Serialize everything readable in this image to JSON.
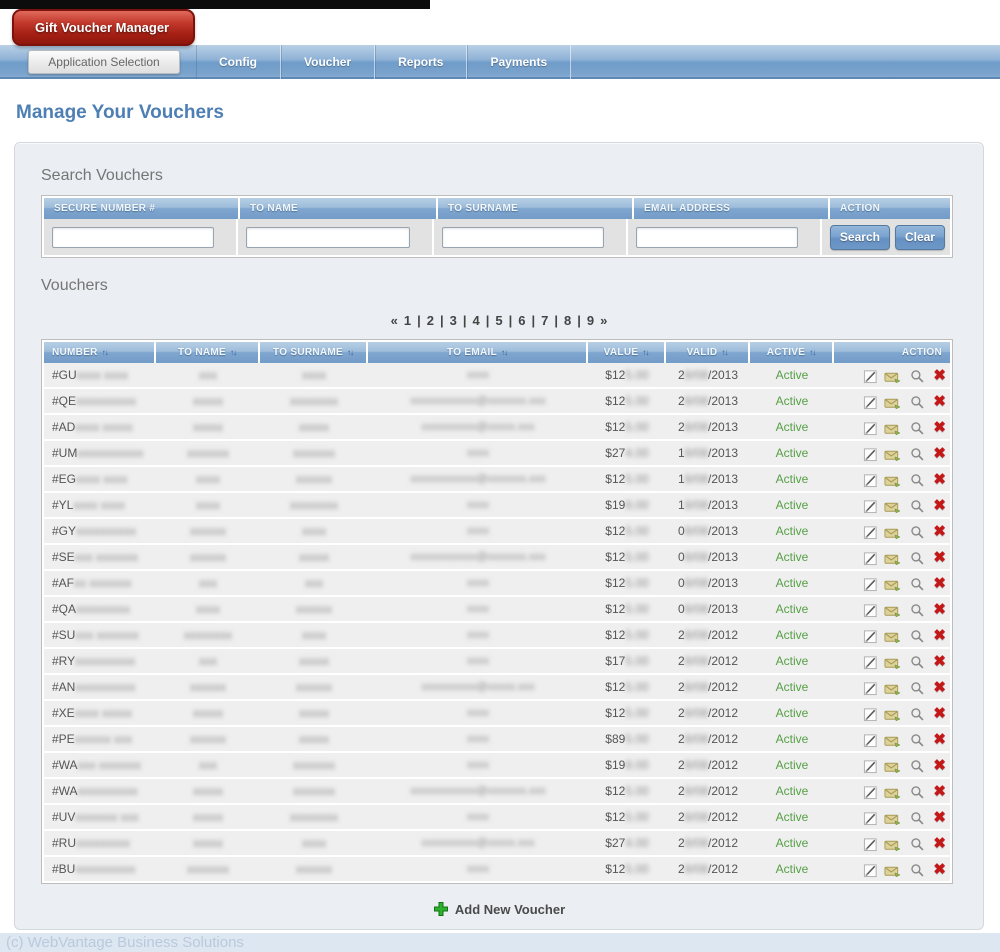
{
  "app": {
    "logo_label": "Gift Voucher Manager",
    "footer": "(c) WebVantage Business Solutions"
  },
  "nav": {
    "app_selection_label": "Application Selection",
    "tabs": [
      {
        "label": "Config"
      },
      {
        "label": "Voucher"
      },
      {
        "label": "Reports"
      },
      {
        "label": "Payments"
      }
    ]
  },
  "page": {
    "title": "Manage Your Vouchers"
  },
  "search": {
    "heading": "Search Vouchers",
    "columns": [
      "SECURE NUMBER #",
      "TO NAME",
      "TO SURNAME",
      "EMAIL ADDRESS",
      "ACTION"
    ],
    "inputs": [
      {
        "name": "secure-number-input",
        "value": ""
      },
      {
        "name": "to-name-input",
        "value": ""
      },
      {
        "name": "to-surname-input",
        "value": ""
      },
      {
        "name": "email-address-input",
        "value": ""
      }
    ],
    "search_label": "Search",
    "clear_label": "Clear"
  },
  "vouchers": {
    "heading": "Vouchers",
    "pagination": {
      "prev": "«",
      "pages": [
        "1",
        "2",
        "3",
        "4",
        "5",
        "6",
        "7",
        "8",
        "9"
      ],
      "separator": "|",
      "next": "»"
    },
    "columns": [
      "NUMBER",
      "TO NAME",
      "TO SURNAME",
      "TO EMAIL",
      "VALUE",
      "VALID",
      "ACTIVE",
      "ACTION"
    ],
    "sort_glyph": "↑↓",
    "add_label": "Add New Voucher",
    "rows": [
      {
        "n": "#GU",
        "nb": "xxxx xxxx",
        "nm": "xxx",
        "sn": "xxxx",
        "em": "xxxx",
        "v": "$12",
        "vb": "5.00",
        "d": "2",
        "db": "8/08",
        "y": "/2013",
        "active": "Active"
      },
      {
        "n": "#QE",
        "nb": "xxxxxxxxxx",
        "nm": "xxxxx",
        "sn": "xxxxxxxx",
        "em": "xxxxxxxxxxxx@xxxxxxx.xxx",
        "v": "$12",
        "vb": "5.00",
        "d": "2",
        "db": "8/08",
        "y": "/2013",
        "active": "Active"
      },
      {
        "n": "#AD",
        "nb": "xxxx xxxxx",
        "nm": "xxxxx",
        "sn": "xxxxx",
        "em": "xxxxxxxxxx@xxxxx.xxx",
        "v": "$12",
        "vb": "5.00",
        "d": "2",
        "db": "8/08",
        "y": "/2013",
        "active": "Active"
      },
      {
        "n": "#UM",
        "nb": "xxxxxxxxxxx",
        "nm": "xxxxxxx",
        "sn": "xxxxxxx",
        "em": "xxxx",
        "v": "$27",
        "vb": "4.00",
        "d": "1",
        "db": "8/08",
        "y": "/2013",
        "active": "Active"
      },
      {
        "n": "#EG",
        "nb": "xxxx xxxx",
        "nm": "xxxx",
        "sn": "xxxxxx",
        "em": "xxxxxxxxxxxx@xxxxxxx.xxx",
        "v": "$12",
        "vb": "5.00",
        "d": "1",
        "db": "8/08",
        "y": "/2013",
        "active": "Active"
      },
      {
        "n": "#YL",
        "nb": "xxxx xxxx",
        "nm": "xxxx",
        "sn": "xxxxxxxx",
        "em": "xxxx",
        "v": "$19",
        "vb": "8.00",
        "d": "1",
        "db": "8/08",
        "y": "/2013",
        "active": "Active"
      },
      {
        "n": "#GY",
        "nb": "xxxxxxxxxx",
        "nm": "xxxxxx",
        "sn": "xxxx",
        "em": "xxxx",
        "v": "$12",
        "vb": "5.00",
        "d": "0",
        "db": "8/08",
        "y": "/2013",
        "active": "Active"
      },
      {
        "n": "#SE",
        "nb": "xxx xxxxxxx",
        "nm": "xxxxxx",
        "sn": "xxxxx",
        "em": "xxxxxxxxxxxx@xxxxxxx.xxx",
        "v": "$12",
        "vb": "5.00",
        "d": "0",
        "db": "8/08",
        "y": "/2013",
        "active": "Active"
      },
      {
        "n": "#AF",
        "nb": "xx xxxxxxx",
        "nm": "xxx",
        "sn": "xxx",
        "em": "xxxx",
        "v": "$12",
        "vb": "5.00",
        "d": "0",
        "db": "8/08",
        "y": "/2013",
        "active": "Active"
      },
      {
        "n": "#QA",
        "nb": "xxxxxxxxx",
        "nm": "xxxx",
        "sn": "xxxxxx",
        "em": "xxxx",
        "v": "$12",
        "vb": "5.00",
        "d": "0",
        "db": "8/08",
        "y": "/2013",
        "active": "Active"
      },
      {
        "n": "#SU",
        "nb": "xxx xxxxxxx",
        "nm": "xxxxxxxx",
        "sn": "xxxx",
        "em": "xxxx",
        "v": "$12",
        "vb": "5.00",
        "d": "2",
        "db": "8/08",
        "y": "/2012",
        "active": "Active"
      },
      {
        "n": "#RY",
        "nb": "xxxxxxxxxx",
        "nm": "xxx",
        "sn": "xxxxx",
        "em": "xxxx",
        "v": "$17",
        "vb": "5.00",
        "d": "2",
        "db": "8/08",
        "y": "/2012",
        "active": "Active"
      },
      {
        "n": "#AN",
        "nb": "xxxxxxxxxx",
        "nm": "xxxxxx",
        "sn": "xxxxxx",
        "em": "xxxxxxxxxx@xxxxx.xxx",
        "v": "$12",
        "vb": "5.00",
        "d": "2",
        "db": "8/08",
        "y": "/2012",
        "active": "Active"
      },
      {
        "n": "#XE",
        "nb": "xxxx xxxxx",
        "nm": "xxxxx",
        "sn": "xxxxx",
        "em": "xxxx",
        "v": "$12",
        "vb": "5.00",
        "d": "2",
        "db": "8/08",
        "y": "/2012",
        "active": "Active"
      },
      {
        "n": "#PE",
        "nb": "xxxxxx xxx",
        "nm": "xxxxxx",
        "sn": "xxxxx",
        "em": "xxxx",
        "v": "$89",
        "vb": "5.00",
        "d": "2",
        "db": "8/08",
        "y": "/2012",
        "active": "Active"
      },
      {
        "n": "#WA",
        "nb": "xxx xxxxxxx",
        "nm": "xxx",
        "sn": "xxxxxxx",
        "em": "xxxx",
        "v": "$19",
        "vb": "8.00",
        "d": "2",
        "db": "8/08",
        "y": "/2012",
        "active": "Active"
      },
      {
        "n": "#WA",
        "nb": "xxxxxxxxxx",
        "nm": "xxxxx",
        "sn": "xxxxxxx",
        "em": "xxxxxxxxxxxx@xxxxxxx.xxx",
        "v": "$12",
        "vb": "5.00",
        "d": "2",
        "db": "8/08",
        "y": "/2012",
        "active": "Active"
      },
      {
        "n": "#UV",
        "nb": "xxxxxxx xxx",
        "nm": "xxxxx",
        "sn": "xxxxxxxx",
        "em": "xxxx",
        "v": "$12",
        "vb": "5.00",
        "d": "2",
        "db": "8/08",
        "y": "/2012",
        "active": "Active"
      },
      {
        "n": "#RU",
        "nb": "xxxxxxxxx",
        "nm": "xxxxx",
        "sn": "xxxx",
        "em": "xxxxxxxxxx@xxxxx.xxx",
        "v": "$27",
        "vb": "4.00",
        "d": "2",
        "db": "8/08",
        "y": "/2012",
        "active": "Active"
      },
      {
        "n": "#BU",
        "nb": "xxxxxxxxxx",
        "nm": "xxxxxxx",
        "sn": "xxxxxx",
        "em": "xxxx",
        "v": "$12",
        "vb": "5.00",
        "d": "2",
        "db": "8/08",
        "y": "/2012",
        "active": "Active"
      }
    ]
  },
  "icons": {
    "edit": "pencil-square",
    "send": "envelope",
    "view": "magnifier",
    "delete": "red-x",
    "add": "green-plus",
    "sort": "up-down-arrows"
  },
  "colors": {
    "brand_red": "#a51f14",
    "nav_blue": "#6f9cc9",
    "header_blue_top": "#b7cfe5",
    "header_blue_bottom": "#739cc8",
    "title_blue": "#4d7fb5",
    "active_green": "#55a045",
    "delete_red": "#c41818",
    "add_green": "#2db22d",
    "panel_bg": "#ebeff3",
    "row_bg": "#efefef",
    "footer_strip": "#dde7f1"
  }
}
